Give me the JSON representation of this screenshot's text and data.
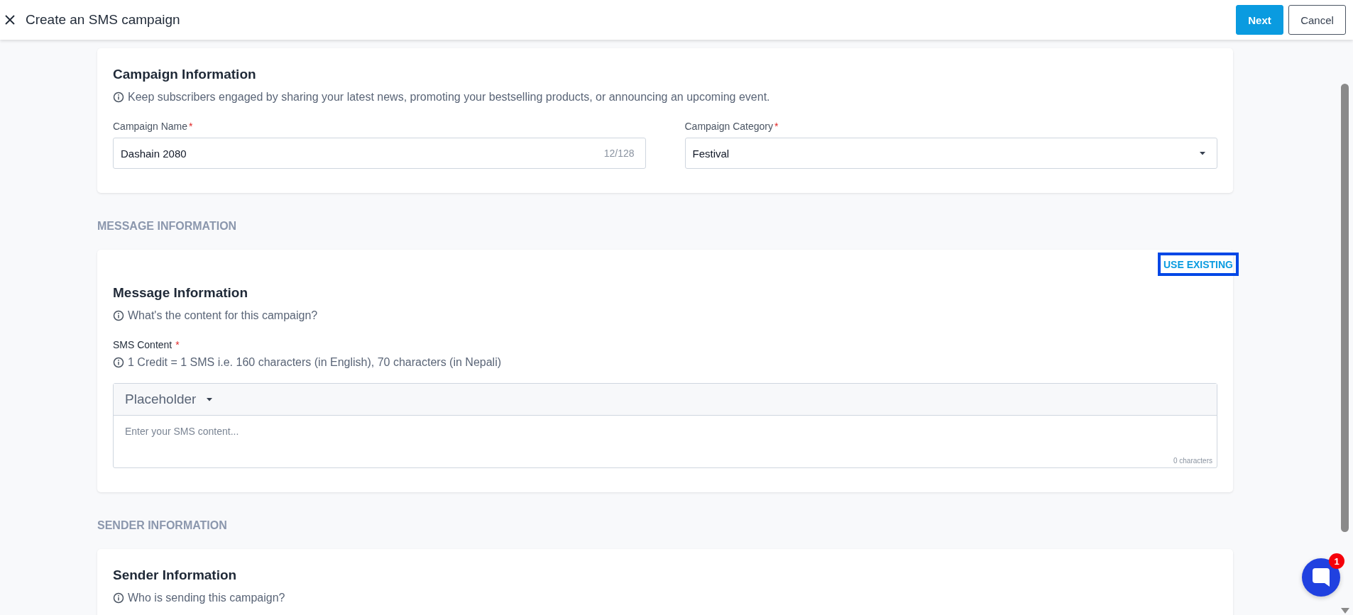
{
  "header": {
    "title": "Create an SMS campaign",
    "buttons": [
      {
        "label": "Next",
        "kind": "primary"
      },
      {
        "label": "Cancel",
        "kind": "secondary"
      }
    ]
  },
  "sections": [
    {
      "title": "Campaign Information",
      "description": "Keep subscribers engaged by sharing your latest news, promoting your bestselling products, or announcing an upcoming event.",
      "fields": [
        {
          "kind": "text",
          "label": "Campaign Name",
          "required_mark": "*",
          "value": "Dashain 2080",
          "counter": "12/128"
        },
        {
          "kind": "select",
          "label": "Campaign Category",
          "required_mark": "*",
          "value": "Festival"
        }
      ]
    },
    {
      "heading": "MESSAGE INFORMATION",
      "action": {
        "label": "USE EXISTING",
        "focused": true
      },
      "title": "Message Information",
      "description": "What's the content for this campaign?",
      "fields": [
        {
          "kind": "editor",
          "label": "SMS Content",
          "required_mark": "*",
          "note": "1 Credit = 1 SMS i.e. 160 characters (in English), 70 characters (in Nepali)",
          "menu": "Placeholder",
          "placeholder": "Enter your SMS content...",
          "counter": "0 characters"
        }
      ]
    },
    {
      "heading": "SENDER INFORMATION",
      "title": "Sender Information",
      "description": "Who is sending this campaign?"
    }
  ],
  "chat": {
    "badge": "1"
  }
}
